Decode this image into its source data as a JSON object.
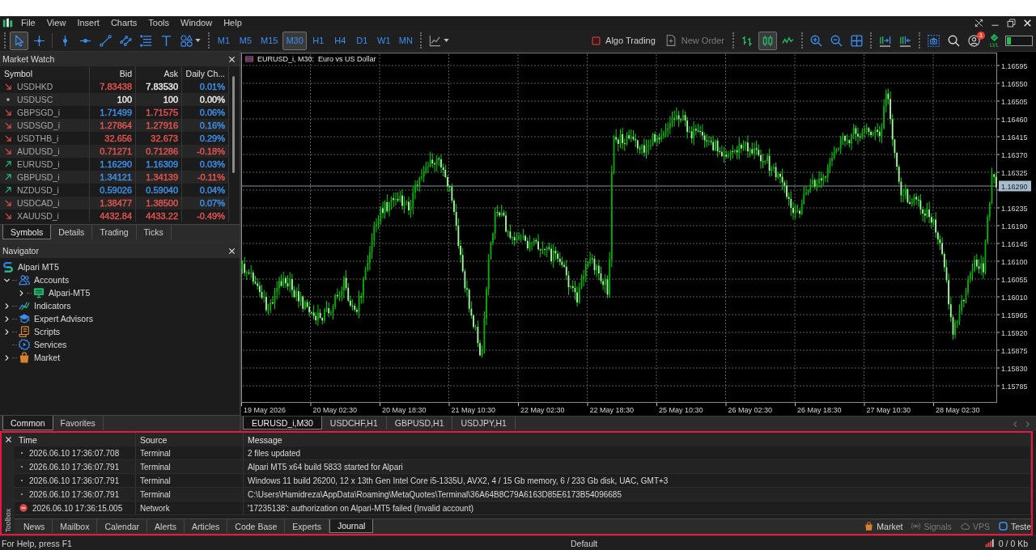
{
  "menu_bar": {
    "items": [
      "File",
      "View",
      "Insert",
      "Charts",
      "Tools",
      "Window",
      "Help"
    ]
  },
  "toolbar": {
    "drawing_tools": [
      {
        "kind": "cursor",
        "selected": true
      },
      {
        "kind": "crosshair",
        "selected": false
      },
      {
        "kind": "vline",
        "selected": false
      },
      {
        "kind": "hline",
        "selected": false
      },
      {
        "kind": "trendline",
        "selected": false
      },
      {
        "kind": "channel",
        "selected": false
      },
      {
        "kind": "fibo",
        "selected": false
      },
      {
        "kind": "text",
        "selected": false
      },
      {
        "kind": "shapes",
        "selected": false
      }
    ],
    "timeframes": [
      {
        "label": "M1",
        "selected": false
      },
      {
        "label": "M5",
        "selected": false
      },
      {
        "label": "M15",
        "selected": false
      },
      {
        "label": "M30",
        "selected": true
      },
      {
        "label": "H1",
        "selected": false
      },
      {
        "label": "H4",
        "selected": false
      },
      {
        "label": "D1",
        "selected": false
      },
      {
        "label": "W1",
        "selected": false
      },
      {
        "label": "MN",
        "selected": false
      }
    ],
    "algo_trading": {
      "label": "Algo Trading",
      "on": false
    },
    "new_order": {
      "label": "New Order",
      "disabled": true
    },
    "chart_types": [
      {
        "kind": "bars",
        "selected": false
      },
      {
        "kind": "candles",
        "selected": true
      },
      {
        "kind": "line",
        "selected": false
      }
    ],
    "notifications_badge": "1",
    "level_button": "LVL",
    "meter": {
      "level": 0.15
    }
  },
  "market_watch": {
    "title": "Market Watch",
    "columns": [
      "Symbol",
      "Bid",
      "Ask",
      "Daily Ch..."
    ],
    "rows": [
      {
        "kind": "down",
        "symbol": "USDHKD",
        "bid": {
          "value": "7.83438",
          "color": "#e2534f"
        },
        "ask": {
          "value": "7.83530",
          "color": "#e8e8e8"
        },
        "change": {
          "value": "0.01%",
          "color": "#3d8fe8"
        }
      },
      {
        "kind": "flat",
        "symbol": "USDUSC",
        "bid": {
          "value": "100",
          "color": "#e8e8e8"
        },
        "ask": {
          "value": "100",
          "color": "#e8e8e8"
        },
        "change": {
          "value": "0.00%",
          "color": "#e8e8e8"
        }
      },
      {
        "kind": "down",
        "symbol": "GBPSGD_i",
        "bid": {
          "value": "1.71499",
          "color": "#3d8fe8"
        },
        "ask": {
          "value": "1.71575",
          "color": "#e2534f"
        },
        "change": {
          "value": "0.06%",
          "color": "#3d8fe8"
        }
      },
      {
        "kind": "down",
        "symbol": "USDSGD_i",
        "bid": {
          "value": "1.27864",
          "color": "#e2534f"
        },
        "ask": {
          "value": "1.27916",
          "color": "#e2534f"
        },
        "change": {
          "value": "0.16%",
          "color": "#3d8fe8"
        }
      },
      {
        "kind": "down",
        "symbol": "USDTHB_i",
        "bid": {
          "value": "32.656",
          "color": "#e2534f"
        },
        "ask": {
          "value": "32.673",
          "color": "#e2534f"
        },
        "change": {
          "value": "0.29%",
          "color": "#3d8fe8"
        }
      },
      {
        "kind": "down",
        "symbol": "AUDUSD_i",
        "bid": {
          "value": "0.71271",
          "color": "#e2534f"
        },
        "ask": {
          "value": "0.71286",
          "color": "#e2534f"
        },
        "change": {
          "value": "-0.18%",
          "color": "#e2534f"
        }
      },
      {
        "kind": "up",
        "symbol": "EURUSD_i",
        "bid": {
          "value": "1.16290",
          "color": "#3d8fe8"
        },
        "ask": {
          "value": "1.16309",
          "color": "#3d8fe8"
        },
        "change": {
          "value": "0.03%",
          "color": "#3d8fe8"
        }
      },
      {
        "kind": "up",
        "symbol": "GBPUSD_i",
        "bid": {
          "value": "1.34121",
          "color": "#3d8fe8"
        },
        "ask": {
          "value": "1.34139",
          "color": "#e2534f"
        },
        "change": {
          "value": "-0.11%",
          "color": "#e2534f"
        }
      },
      {
        "kind": "up",
        "symbol": "NZDUSD_i",
        "bid": {
          "value": "0.59026",
          "color": "#3d8fe8"
        },
        "ask": {
          "value": "0.59040",
          "color": "#3d8fe8"
        },
        "change": {
          "value": "0.04%",
          "color": "#3d8fe8"
        }
      },
      {
        "kind": "down",
        "symbol": "USDCAD_i",
        "bid": {
          "value": "1.38477",
          "color": "#e2534f"
        },
        "ask": {
          "value": "1.38500",
          "color": "#e2534f"
        },
        "change": {
          "value": "0.07%",
          "color": "#3d8fe8"
        }
      },
      {
        "kind": "down",
        "symbol": "XAUUSD_i",
        "bid": {
          "value": "4432.84",
          "color": "#e2534f"
        },
        "ask": {
          "value": "4433.22",
          "color": "#e2534f"
        },
        "change": {
          "value": "-0.49%",
          "color": "#e2534f"
        }
      }
    ],
    "tabs": [
      {
        "label": "Symbols",
        "selected": true
      },
      {
        "label": "Details",
        "selected": false
      },
      {
        "label": "Trading",
        "selected": false
      },
      {
        "label": "Ticks",
        "selected": false
      }
    ]
  },
  "navigator": {
    "title": "Navigator",
    "tree": [
      {
        "label": "Alpari MT5",
        "kind": "terminal",
        "children": [
          {
            "label": "Accounts",
            "kind": "accounts",
            "expanded": true,
            "children": [
              {
                "label": "Alpari-MT5",
                "kind": "server",
                "expanded": false
              }
            ]
          },
          {
            "label": "Indicators",
            "kind": "indicators",
            "expanded": false
          },
          {
            "label": "Expert Advisors",
            "kind": "advisors",
            "expanded": false
          },
          {
            "label": "Scripts",
            "kind": "scripts",
            "expanded": false
          },
          {
            "label": "Services",
            "kind": "services"
          },
          {
            "label": "Market",
            "kind": "market",
            "expanded": false
          }
        ]
      }
    ],
    "tabs": [
      {
        "label": "Common",
        "selected": true
      },
      {
        "label": "Favorites",
        "selected": false
      }
    ]
  },
  "chart": {
    "title": "EURUSD_i, M30:",
    "description": "Euro vs US Dollar",
    "price_axis": {
      "above_bid": [
        "1.16595",
        "1.16550",
        "1.16505",
        "1.16460",
        "1.16415",
        "1.16370",
        "1.16325"
      ],
      "bid": "1.16290",
      "below_bid": [
        "1.16235",
        "1.16190",
        "1.16145",
        "1.16100",
        "1.16055",
        "1.16010",
        "1.15965",
        "1.15920",
        "1.15875",
        "1.15830",
        "1.15785"
      ]
    },
    "time_axis": [
      "19 May 2026",
      "20 May 02:30",
      "20 May 18:30",
      "21 May 10:30",
      "22 May 02:30",
      "22 May 18:30",
      "25 May 10:30",
      "26 May 02:30",
      "26 May 18:30",
      "27 May 10:30",
      "28 May 02:30"
    ],
    "tabs": [
      {
        "label": "EURUSD_i,M30",
        "selected": true
      },
      {
        "label": "USDCHF,H1",
        "selected": false
      },
      {
        "label": "GBPUSD,H1",
        "selected": false
      },
      {
        "label": "USDJPY,H1",
        "selected": false
      }
    ]
  },
  "toolbox": {
    "title": "Toolbox",
    "columns": [
      "Time",
      "Source",
      "Message"
    ],
    "rows": [
      {
        "kind": "info",
        "time": "2026.06.10 17:36:07.708",
        "source": "Terminal",
        "message": "2 files updated"
      },
      {
        "kind": "info",
        "time": "2026.06.10 17:36:07.791",
        "source": "Terminal",
        "message": "Alpari MT5 x64 build 5833 started for Alpari"
      },
      {
        "kind": "info",
        "time": "2026.06.10 17:36:07.791",
        "source": "Terminal",
        "message": "Windows 11 build 26200, 12 x 13th Gen Intel Core i5-1335U, AVX2, 4 / 15 Gb memory, 6 / 233 Gb disk, UAC, GMT+3"
      },
      {
        "kind": "info",
        "time": "2026.06.10 17:36:07.791",
        "source": "Terminal",
        "message": "C:\\Users\\Hamidreza\\AppData\\Roaming\\MetaQuotes\\Terminal\\36A64B8C79A6163D85E6173B54096685"
      },
      {
        "kind": "error",
        "time": "2026.06.10 17:36:15.005",
        "source": "Network",
        "message": "'17235138': authorization on Alpari-MT5 failed (Invalid account)"
      }
    ],
    "tabs": [
      {
        "label": "News",
        "selected": false
      },
      {
        "label": "Mailbox",
        "selected": false
      },
      {
        "label": "Calendar",
        "selected": false
      },
      {
        "label": "Alerts",
        "selected": false
      },
      {
        "label": "Articles",
        "selected": false
      },
      {
        "label": "Code Base",
        "selected": false
      },
      {
        "label": "Experts",
        "selected": false
      },
      {
        "label": "Journal",
        "selected": true
      }
    ],
    "services": [
      {
        "kind": "market",
        "label": "Market",
        "disabled": false
      },
      {
        "kind": "signals",
        "label": "Signals",
        "disabled": true
      },
      {
        "kind": "vps",
        "label": "VPS",
        "disabled": true
      },
      {
        "kind": "tester",
        "label": "Teste",
        "disabled": false
      }
    ]
  },
  "status_bar": {
    "help": "For Help, press F1",
    "profile": "Default",
    "traffic": "0 / 0 Kb"
  }
}
